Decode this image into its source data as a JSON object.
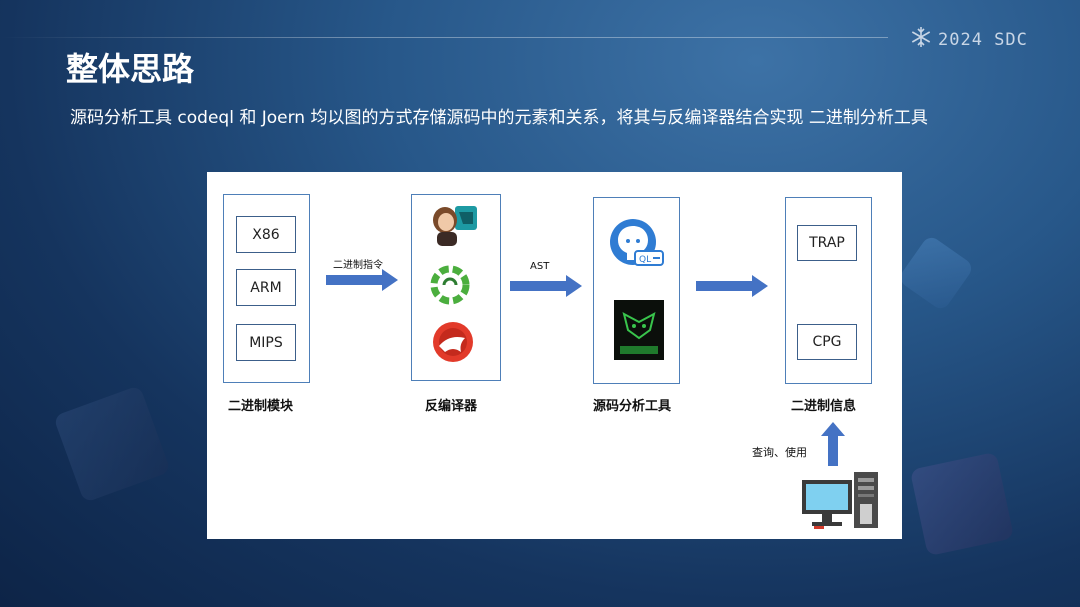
{
  "header": {
    "title": "整体思路",
    "subtitle": "源码分析工具 codeql 和 Joern 均以图的方式存储源码中的元素和关系，将其与反编译器结合实现 二进制分析工具",
    "brand": "2024 SDC"
  },
  "diagram": {
    "binary_module": {
      "label": "二进制模块",
      "items": [
        "X86",
        "ARM",
        "MIPS"
      ]
    },
    "arrow1_label": "二进制指令",
    "decompiler": {
      "label": "反编译器",
      "icons": [
        "binary-ninja-icon",
        "angr-gear-icon",
        "ida-icon"
      ]
    },
    "arrow2_label": "AST",
    "source_tools": {
      "label": "源码分析工具",
      "icons": [
        "codeql-icon",
        "joern-icon"
      ]
    },
    "binary_info": {
      "label": "二进制信息",
      "items": [
        "TRAP",
        "CPG"
      ]
    },
    "query_label": "查询、使用",
    "colors": {
      "arrow": "#4472c4",
      "box_border": "#4e7fb8"
    }
  }
}
